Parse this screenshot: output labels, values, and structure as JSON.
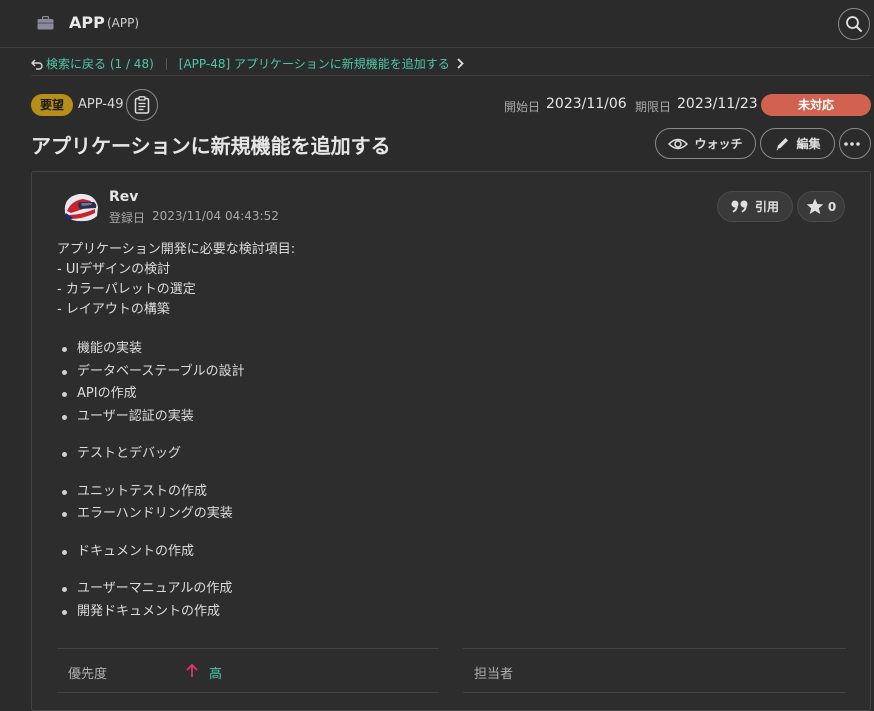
{
  "header": {
    "project_key": "APP",
    "project_sub": "(APP)"
  },
  "breadcrumb": {
    "back_label": "検索に戻る (1 / 48)",
    "current_label": "[APP-48] アプリケーションに新規機能を追加する"
  },
  "issue": {
    "type": "要望",
    "key": "APP-49",
    "start_label": "開始日",
    "start_date": "2023/11/06",
    "due_label": "期限日",
    "due_date": "2023/11/23",
    "status": "未対応",
    "title": "アプリケーションに新規機能を追加する"
  },
  "actions": {
    "watch_label": "ウォッチ",
    "edit_label": "編集"
  },
  "comment": {
    "author": "Rev",
    "created_label": "登録日",
    "created_at": "2023/11/04 04:43:52",
    "quote_label": "引用",
    "star_count": "0"
  },
  "description": {
    "lines": [
      "アプリケーション開発に必要な検討項目:",
      "- UIデザインの検討",
      "- カラーパレットの選定",
      "- レイアウトの構築"
    ],
    "group1": [
      "機能の実装",
      "データベーステーブルの設計",
      "APIの作成",
      "ユーザー認証の実装"
    ],
    "group2": [
      "テストとデバッグ"
    ],
    "group3": [
      "ユニットテストの作成",
      "エラーハンドリングの実装"
    ],
    "group4": [
      "ドキュメントの作成"
    ],
    "group5": [
      "ユーザーマニュアルの作成",
      "開発ドキュメントの作成"
    ]
  },
  "fields": {
    "priority_label": "優先度",
    "priority_value": "高",
    "assignee_label": "担当者"
  },
  "colors": {
    "accent": "#4dc7a8",
    "status": "#d0624f",
    "type_badge": "#b78f18",
    "priority_up": "#e5346d"
  }
}
